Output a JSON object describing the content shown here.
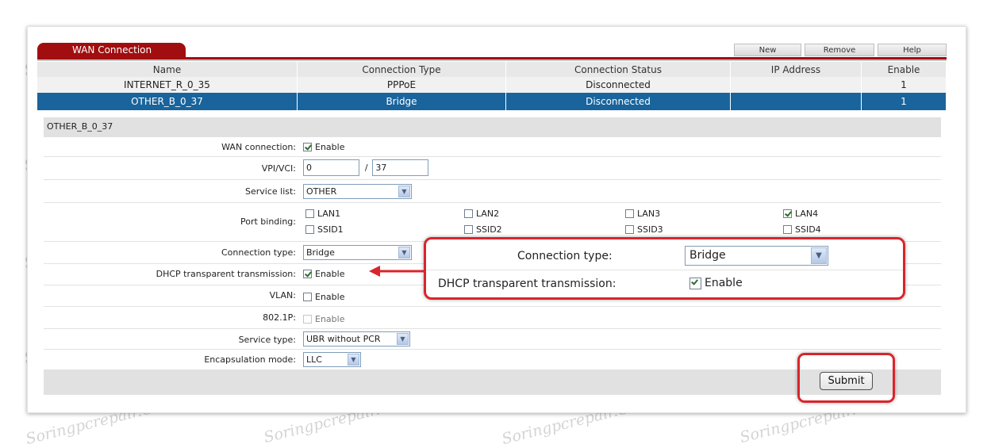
{
  "header": {
    "tab_label": "WAN Connection",
    "buttons": {
      "new": "New",
      "remove": "Remove",
      "help": "Help"
    }
  },
  "connections": {
    "columns": [
      "Name",
      "Connection Type",
      "Connection Status",
      "IP Address",
      "Enable"
    ],
    "rows": [
      {
        "name": "INTERNET_R_0_35",
        "type": "PPPoE",
        "status": "Disconnected",
        "ip": "",
        "enable": "1"
      },
      {
        "name": "OTHER_B_0_37",
        "type": "Bridge",
        "status": "Disconnected",
        "ip": "",
        "enable": "1",
        "selected": true
      }
    ]
  },
  "detail": {
    "title": "OTHER_B_0_37",
    "wan_connection": {
      "label": "WAN connection:",
      "checkbox_label": "Enable",
      "checked": true
    },
    "vpi_vci": {
      "label": "VPI/VCI:",
      "vpi": "0",
      "separator": "/",
      "vci": "37"
    },
    "service_list": {
      "label": "Service list:",
      "value": "OTHER"
    },
    "port_binding": {
      "label": "Port binding:",
      "ports": [
        {
          "name": "LAN1",
          "checked": false
        },
        {
          "name": "LAN2",
          "checked": false
        },
        {
          "name": "LAN3",
          "checked": false
        },
        {
          "name": "LAN4",
          "checked": true
        },
        {
          "name": "SSID1",
          "checked": false
        },
        {
          "name": "SSID2",
          "checked": false
        },
        {
          "name": "SSID3",
          "checked": false
        },
        {
          "name": "SSID4",
          "checked": false
        }
      ]
    },
    "connection_type": {
      "label": "Connection type:",
      "value": "Bridge"
    },
    "dhcp_transparent": {
      "label": "DHCP transparent transmission:",
      "checkbox_label": "Enable",
      "checked": true
    },
    "vlan": {
      "label": "VLAN:",
      "checkbox_label": "Enable",
      "checked": false
    },
    "p8021": {
      "label": "802.1P:",
      "checkbox_label": "Enable",
      "checked": false,
      "disabled": true
    },
    "service_type": {
      "label": "Service type:",
      "value": "UBR without PCR"
    },
    "encapsulation": {
      "label": "Encapsulation mode:",
      "value": "LLC"
    },
    "submit_label": "Submit"
  },
  "callout": {
    "connection_type_label": "Connection type:",
    "connection_type_value": "Bridge",
    "dhcp_label": "DHCP transparent transmission:",
    "dhcp_checkbox_label": "Enable"
  },
  "watermark": "Soringpcrepair.Com",
  "colors": {
    "accent_red": "#a10e10",
    "selected_row": "#19649c",
    "highlight": "#d9252b"
  }
}
